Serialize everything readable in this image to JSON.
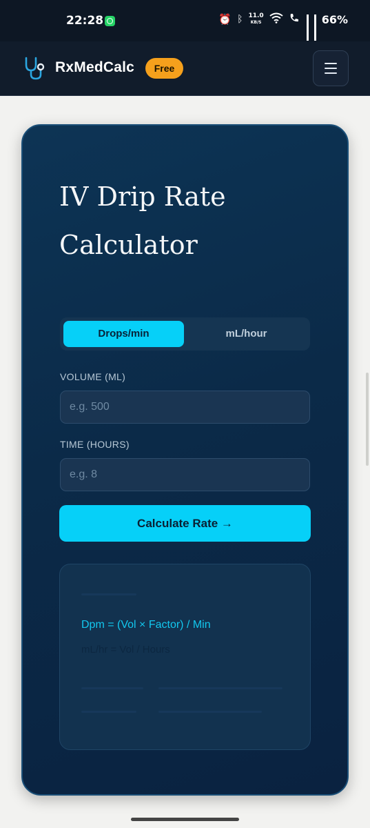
{
  "status_bar": {
    "time": "22:28",
    "net_speed_value": "11.0",
    "net_speed_unit": "KB/S",
    "battery": "66%"
  },
  "header": {
    "brand": "RxMedCalc",
    "badge": "Free",
    "menu_glyph": "☰"
  },
  "calculator": {
    "title_line1": "IV Drip Rate",
    "title_line2": "Calculator",
    "tabs": [
      {
        "label": "Drops/min",
        "active": true
      },
      {
        "label": "mL/hour",
        "active": false
      }
    ],
    "volume_label": "VOLUME (ML)",
    "volume_placeholder": "e.g. 500",
    "time_label": "TIME (HOURS)",
    "time_placeholder": "e.g. 8",
    "calculate_label": "Calculate Rate →",
    "result": {
      "formula_dpm": "Dpm = (Vol × Factor) / Min",
      "formula_mlhr": "mL/hr = Vol / Hours"
    }
  },
  "colors": {
    "accent": "#06d0f8",
    "badge": "#f5a01c",
    "card": "#0b2a48"
  }
}
